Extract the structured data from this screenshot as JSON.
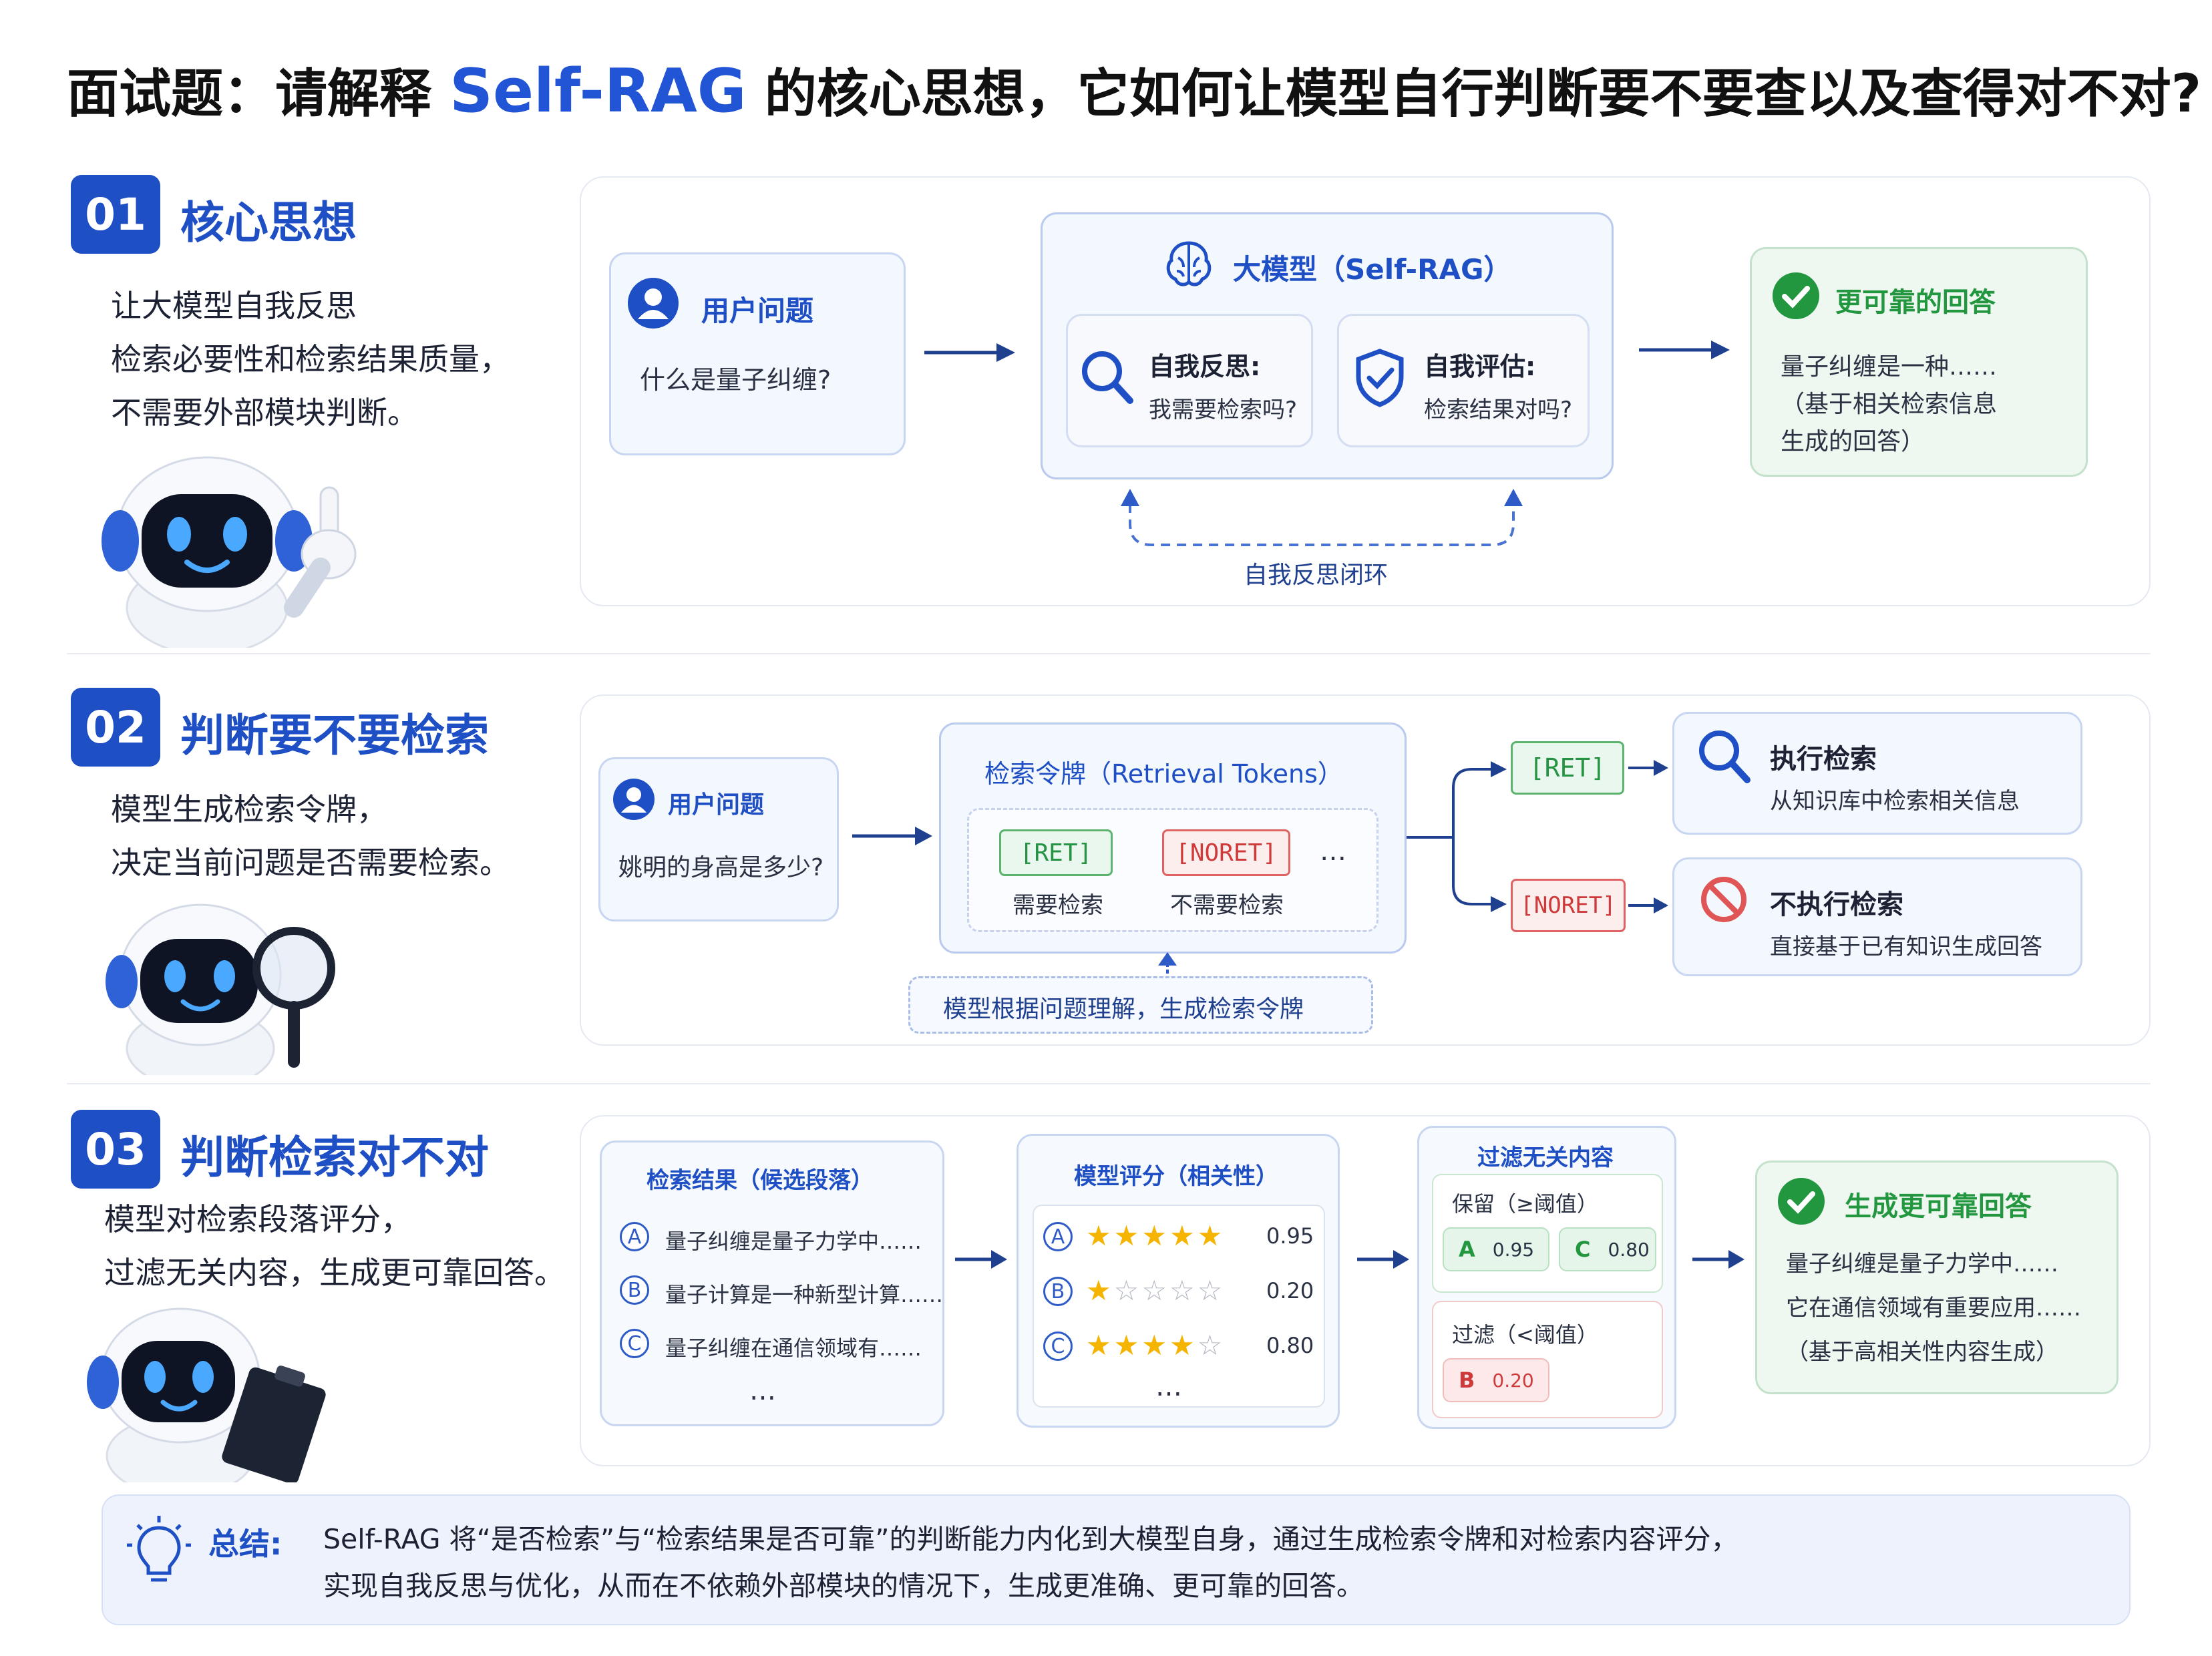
{
  "title": {
    "prefix": "面试题：请解释",
    "highlight": "Self-RAG",
    "suffix": "的核心思想，它如何让模型自行判断要不要查以及查得对不对?"
  },
  "sections": [
    {
      "num": "01",
      "title": "核心思想",
      "desc": [
        "让大模型自我反思",
        "检索必要性和检索结果质量，",
        "不需要外部模块判断。"
      ]
    },
    {
      "num": "02",
      "title": "判断要不要检索",
      "desc": [
        "模型生成检索令牌，",
        "决定当前问题是否需要检索。"
      ]
    },
    {
      "num": "03",
      "title": "判断检索对不对",
      "desc": [
        "模型对检索段落评分，",
        "过滤无关内容，生成更可靠回答。"
      ]
    }
  ],
  "s1": {
    "user_title": "用户问题",
    "user_q": "什么是量子纠缠?",
    "model_title": "大模型（Self-RAG）",
    "reflect_title": "自我反思:",
    "reflect_text": "我需要检索吗?",
    "eval_title": "自我评估:",
    "eval_text": "检索结果对吗?",
    "loop_label": "自我反思闭环",
    "answer_title": "更可靠的回答",
    "answer_lines": [
      "量子纠缠是一种……",
      "（基于相关检索信息",
      "生成的回答）"
    ]
  },
  "s2": {
    "user_title": "用户问题",
    "user_q": "姚明的身高是多少?",
    "tokens_title": "检索令牌（Retrieval Tokens）",
    "tag_ret": "[RET]",
    "tag_noret": "[NORET]",
    "ret_desc": "需要检索",
    "noret_desc": "不需要检索",
    "ellipsis": "…",
    "note": "模型根据问题理解，生成检索令牌",
    "branch_ret": "[RET]",
    "branch_noret": "[NORET]",
    "do_title": "执行检索",
    "do_text": "从知识库中检索相关信息",
    "no_title": "不执行检索",
    "no_text": "直接基于已有知识生成回答"
  },
  "s3": {
    "results_title": "检索结果（候选段落）",
    "results": [
      {
        "id": "A",
        "text": "量子纠缠是量子力学中……"
      },
      {
        "id": "B",
        "text": "量子计算是一种新型计算……"
      },
      {
        "id": "C",
        "text": "量子纠缠在通信领域有……"
      }
    ],
    "results_more": "…",
    "score_title": "模型评分（相关性）",
    "scores": [
      {
        "id": "A",
        "stars": 5,
        "score": "0.95"
      },
      {
        "id": "B",
        "stars": 1,
        "score": "0.20"
      },
      {
        "id": "C",
        "stars": 4,
        "score": "0.80"
      }
    ],
    "score_more": "…",
    "filter_title": "过滤无关内容",
    "keep_label": "保留（≥阈值）",
    "keep": [
      {
        "id": "A",
        "score": "0.95"
      },
      {
        "id": "C",
        "score": "0.80"
      }
    ],
    "drop_label": "过滤（<阈值）",
    "drop": [
      {
        "id": "B",
        "score": "0.20"
      }
    ],
    "final_title": "生成更可靠回答",
    "final_lines": [
      "量子纠缠是量子力学中……",
      "它在通信领域有重要应用……",
      "（基于高相关性内容生成）"
    ]
  },
  "summary": {
    "label": "总结:",
    "line1": "Self-RAG 将“是否检索”与“检索结果是否可靠”的判断能力内化到大模型自身，通过生成检索令牌和对检索内容评分，",
    "line2": "实现自我反思与优化，从而在不依赖外部模块的情况下，生成更准确、更可靠的回答。"
  },
  "colors": {
    "accent": "#1f4fc4",
    "green": "#22973f",
    "red": "#cf3a3a",
    "star": "#f5b400"
  }
}
